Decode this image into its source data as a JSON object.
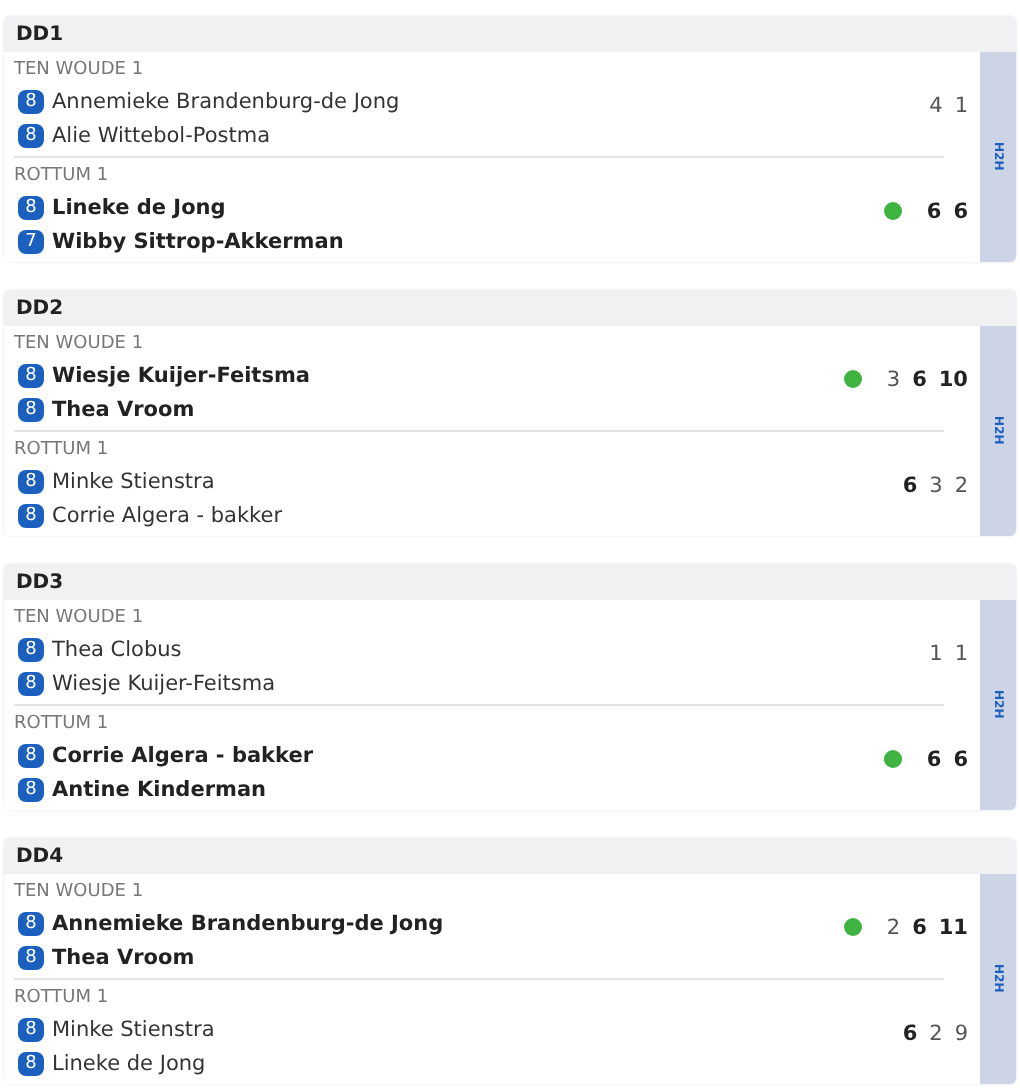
{
  "matches": [
    {
      "title": "DD1",
      "h2h": "H2H",
      "teams": [
        {
          "name": "TEN WOUDE 1",
          "winner": false,
          "players": [
            {
              "rating": "8",
              "name": "Annemieke Brandenburg-de Jong"
            },
            {
              "rating": "8",
              "name": "Alie Wittebol-Postma"
            }
          ],
          "sets": [
            {
              "score": "4",
              "won": false
            },
            {
              "score": "1",
              "won": false
            }
          ]
        },
        {
          "name": "ROTTUM 1",
          "winner": true,
          "players": [
            {
              "rating": "8",
              "name": "Lineke de Jong"
            },
            {
              "rating": "7",
              "name": "Wibby Sittrop-Akkerman"
            }
          ],
          "sets": [
            {
              "score": "6",
              "won": true
            },
            {
              "score": "6",
              "won": true
            }
          ]
        }
      ]
    },
    {
      "title": "DD2",
      "h2h": "H2H",
      "teams": [
        {
          "name": "TEN WOUDE 1",
          "winner": true,
          "players": [
            {
              "rating": "8",
              "name": "Wiesje Kuijer-Feitsma"
            },
            {
              "rating": "8",
              "name": "Thea Vroom"
            }
          ],
          "sets": [
            {
              "score": "3",
              "won": false
            },
            {
              "score": "6",
              "won": true
            },
            {
              "score": "10",
              "won": true
            }
          ]
        },
        {
          "name": "ROTTUM 1",
          "winner": false,
          "players": [
            {
              "rating": "8",
              "name": "Minke Stienstra"
            },
            {
              "rating": "8",
              "name": "Corrie Algera - bakker"
            }
          ],
          "sets": [
            {
              "score": "6",
              "won": true
            },
            {
              "score": "3",
              "won": false
            },
            {
              "score": "2",
              "won": false
            }
          ]
        }
      ]
    },
    {
      "title": "DD3",
      "h2h": "H2H",
      "teams": [
        {
          "name": "TEN WOUDE 1",
          "winner": false,
          "players": [
            {
              "rating": "8",
              "name": "Thea Clobus"
            },
            {
              "rating": "8",
              "name": "Wiesje Kuijer-Feitsma"
            }
          ],
          "sets": [
            {
              "score": "1",
              "won": false
            },
            {
              "score": "1",
              "won": false
            }
          ]
        },
        {
          "name": "ROTTUM 1",
          "winner": true,
          "players": [
            {
              "rating": "8",
              "name": "Corrie Algera - bakker"
            },
            {
              "rating": "8",
              "name": "Antine Kinderman"
            }
          ],
          "sets": [
            {
              "score": "6",
              "won": true
            },
            {
              "score": "6",
              "won": true
            }
          ]
        }
      ]
    },
    {
      "title": "DD4",
      "h2h": "H2H",
      "teams": [
        {
          "name": "TEN WOUDE 1",
          "winner": true,
          "players": [
            {
              "rating": "8",
              "name": "Annemieke Brandenburg-de Jong"
            },
            {
              "rating": "8",
              "name": "Thea Vroom"
            }
          ],
          "sets": [
            {
              "score": "2",
              "won": false
            },
            {
              "score": "6",
              "won": true
            },
            {
              "score": "11",
              "won": true
            }
          ]
        },
        {
          "name": "ROTTUM 1",
          "winner": false,
          "players": [
            {
              "rating": "8",
              "name": "Minke Stienstra"
            },
            {
              "rating": "8",
              "name": "Lineke de Jong"
            }
          ],
          "sets": [
            {
              "score": "6",
              "won": true
            },
            {
              "score": "2",
              "won": false
            },
            {
              "score": "9",
              "won": false
            }
          ]
        }
      ]
    }
  ]
}
